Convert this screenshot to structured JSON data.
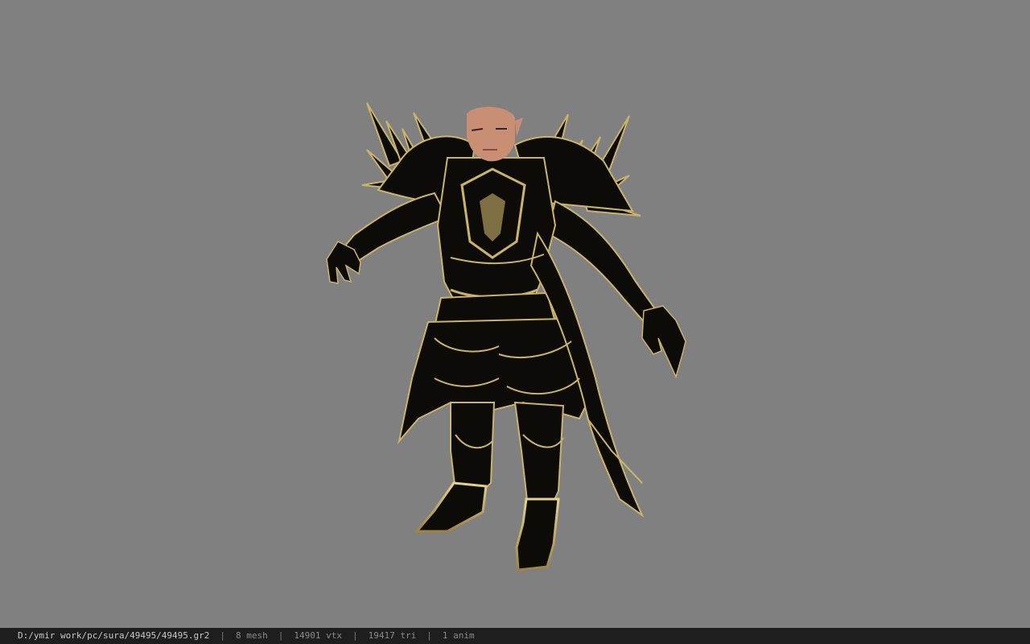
{
  "viewport": {
    "background_color": "#808080",
    "model": {
      "armor_color": "#0d0b08",
      "trim_color": "#c9b46a",
      "skin_color": "#c98f74"
    }
  },
  "status_bar": {
    "file_path": "D:/ymir work/pc/sura/49495/49495.gr2",
    "separator": "|",
    "mesh": "8 mesh",
    "vertices": "14901 vtx",
    "triangles": "19417 tri",
    "animations": "1 anim"
  }
}
